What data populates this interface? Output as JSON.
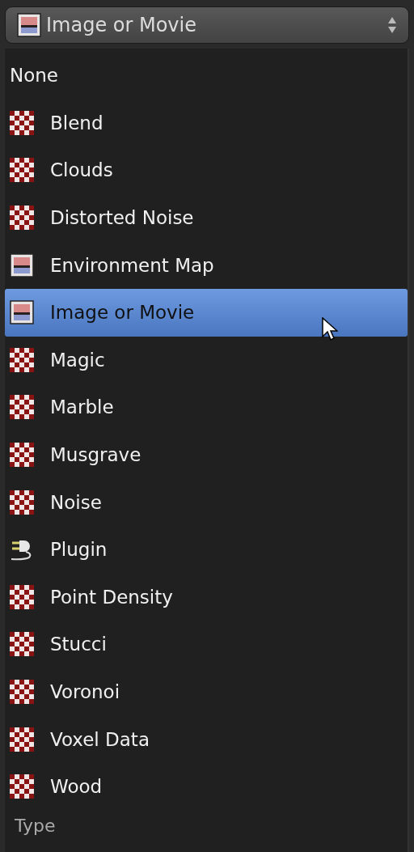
{
  "dropdown": {
    "value": "Image or Movie",
    "kind": "image"
  },
  "menu": {
    "title": "Type",
    "items": [
      {
        "label": "None",
        "kind": "none",
        "selected": false
      },
      {
        "label": "Blend",
        "kind": "checker",
        "selected": false
      },
      {
        "label": "Clouds",
        "kind": "checker",
        "selected": false
      },
      {
        "label": "Distorted Noise",
        "kind": "checker",
        "selected": false
      },
      {
        "label": "Environment Map",
        "kind": "image",
        "selected": false
      },
      {
        "label": "Image or Movie",
        "kind": "image",
        "selected": true
      },
      {
        "label": "Magic",
        "kind": "checker",
        "selected": false
      },
      {
        "label": "Marble",
        "kind": "checker",
        "selected": false
      },
      {
        "label": "Musgrave",
        "kind": "checker",
        "selected": false
      },
      {
        "label": "Noise",
        "kind": "checker",
        "selected": false
      },
      {
        "label": "Plugin",
        "kind": "plugin",
        "selected": false
      },
      {
        "label": "Point Density",
        "kind": "checker",
        "selected": false
      },
      {
        "label": "Stucci",
        "kind": "checker",
        "selected": false
      },
      {
        "label": "Voronoi",
        "kind": "checker",
        "selected": false
      },
      {
        "label": "Voxel Data",
        "kind": "checker",
        "selected": false
      },
      {
        "label": "Wood",
        "kind": "checker",
        "selected": false
      }
    ]
  }
}
